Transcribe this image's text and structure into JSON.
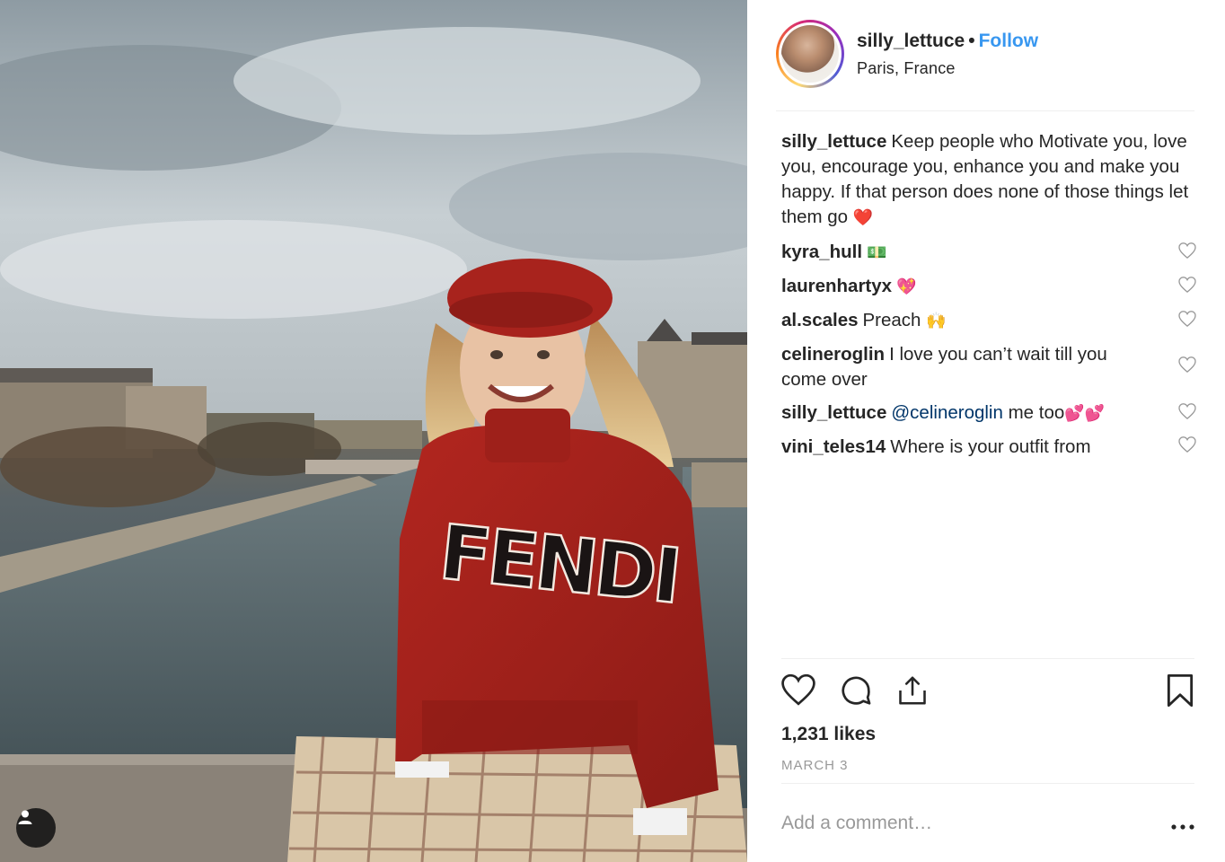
{
  "post": {
    "username": "silly_lettuce",
    "follow_label": "Follow",
    "separator": "•",
    "location": "Paris, France",
    "caption": {
      "user": "silly_lettuce",
      "text": "Keep people who Motivate you, love you, encourage you, enhance you and make you happy. If that person does none of those things let them go",
      "emoji": "❤️"
    },
    "comments": [
      {
        "user": "kyra_hull",
        "text": "",
        "emoji": "💵"
      },
      {
        "user": "laurenhartyx",
        "text": "",
        "emoji": "💖"
      },
      {
        "user": "al.scales",
        "text": "Preach",
        "emoji": "🙌"
      },
      {
        "user": "celineroglin",
        "text": "I love you can’t wait till you come over",
        "emoji": ""
      },
      {
        "user": "silly_lettuce",
        "mention": "@celineroglin",
        "text": "me too",
        "emoji": "💕💕"
      },
      {
        "user": "vini_teles14",
        "text": "Where is your outfit from",
        "emoji": ""
      }
    ],
    "likes": "1,231 likes",
    "date": "MARCH 3",
    "add_comment_placeholder": "Add a comment…",
    "more_label": "•••",
    "photo_sweater_text": "FENDI"
  },
  "icons": {
    "like": "heart-icon",
    "comment": "comment-icon",
    "share": "share-icon",
    "save": "bookmark-icon",
    "tag": "user-tag-icon",
    "more": "more-options-icon"
  },
  "colors": {
    "accent": "#3897f0",
    "text": "#262626",
    "muted": "#999999",
    "mention": "#003569",
    "divider": "#efefef"
  }
}
